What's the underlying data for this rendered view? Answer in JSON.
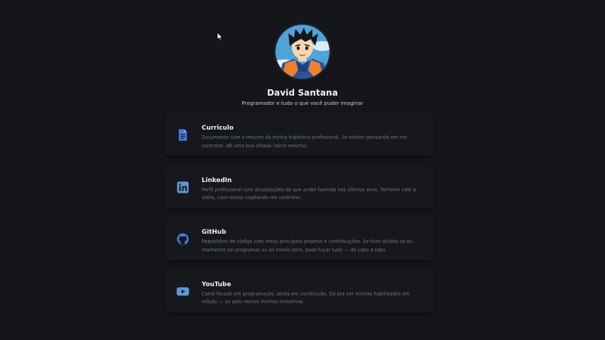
{
  "profile": {
    "name": "David Santana",
    "tagline": "Programador e tudo o que você puder imaginar"
  },
  "links": [
    {
      "title": "Curriculo",
      "description": "Documento com o resumo da minha trajetória profissional. Se estiver pensando em me contratar, dê uma boa olhada (sério mesmo).",
      "icon": "document-icon"
    },
    {
      "title": "LinkedIn",
      "description": "Perfil profissional com atualizações do que andei fazendo nos últimos anos. Também vale a visita, caso esteja cogitando me contratar.",
      "icon": "linkedin-icon"
    },
    {
      "title": "GitHub",
      "description": "Repositório de código com meus principais projetos e contribuições. Se tiver dúvida se eu realmente sei programar ou só enrolo bem, pode fuçar tudo — de cabo a rabo.",
      "icon": "github-icon"
    },
    {
      "title": "YouTube",
      "description": "Canal focado em programação, ainda em construção. Dá pra ver minhas habilidades em edição — ou pelo menos minhas tentativas.",
      "icon": "youtube-icon"
    }
  ],
  "colors": {
    "background": "#15161a",
    "card": "#17181c",
    "accent_blue": "#3f7fe0",
    "light_blue": "#5b9bd5",
    "description": "#6f7484"
  }
}
